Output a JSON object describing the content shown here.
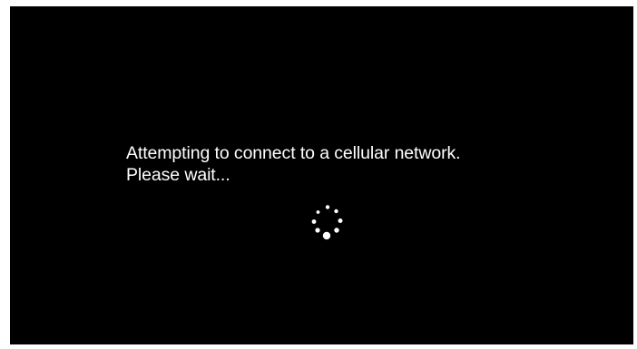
{
  "screen": {
    "background_color": "#000000",
    "text_color": "#ffffff"
  },
  "status": {
    "line1": "Attempting to connect to a cellular network.",
    "line2": "Please wait..."
  },
  "spinner": {
    "icon": "loading-spinner-icon",
    "color": "#ffffff"
  }
}
